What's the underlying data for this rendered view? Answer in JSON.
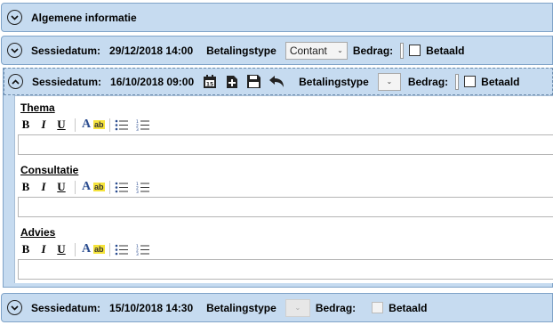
{
  "general": {
    "title": "Algemene informatie"
  },
  "labels": {
    "session_date": "Sessiedatum:",
    "payment_type": "Betalingstype",
    "amount": "Bedrag:",
    "paid": "Betaald"
  },
  "sessions": [
    {
      "date": "29/12/2018 14:00",
      "payment_type": "Contant",
      "expanded": false
    },
    {
      "date": "16/10/2018 09:00",
      "payment_type": "",
      "expanded": true
    },
    {
      "date": "15/10/2018 14:30",
      "payment_type": "",
      "expanded": false
    }
  ],
  "editor": {
    "toolbar": {
      "bold": "B",
      "italic": "I",
      "underline": "U",
      "font_color": "A",
      "highlight": "ab"
    },
    "sections": [
      {
        "title": "Thema",
        "value": ""
      },
      {
        "title": "Consultatie",
        "value": ""
      },
      {
        "title": "Advies",
        "value": ""
      }
    ]
  },
  "icons": [
    "chevron-down-icon",
    "chevron-up-icon",
    "calendar-icon",
    "add-icon",
    "save-icon",
    "undo-icon",
    "bullet-list-icon",
    "numbered-list-icon"
  ]
}
